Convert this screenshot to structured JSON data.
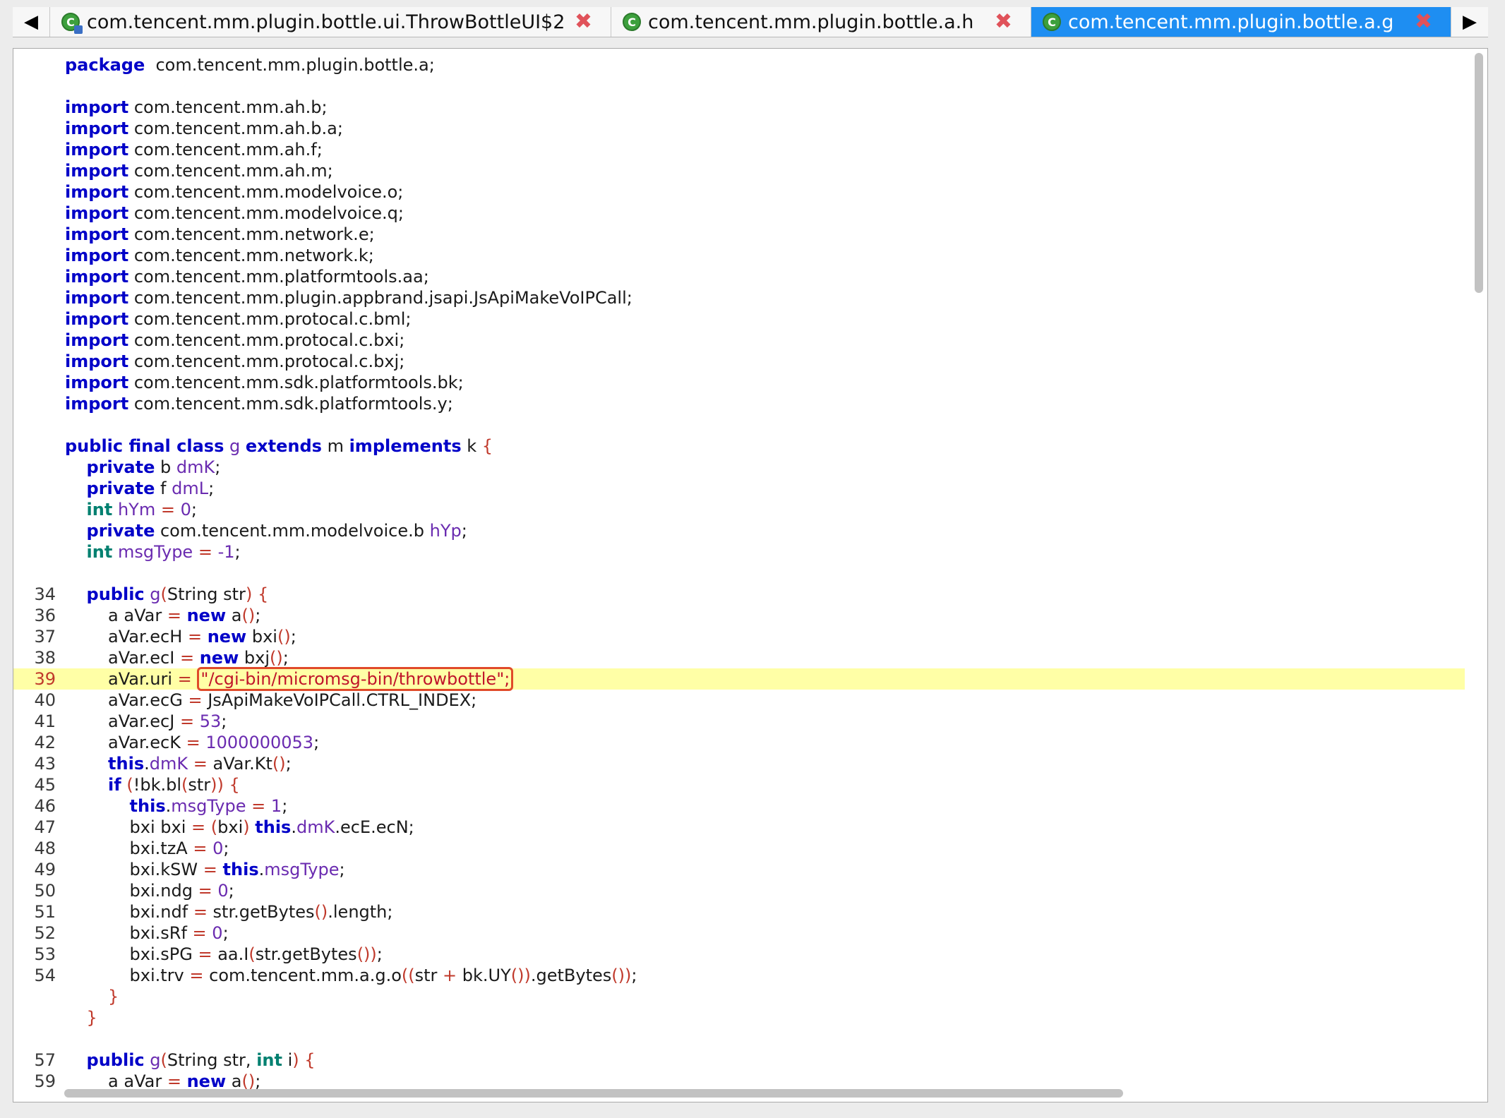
{
  "tabs": [
    {
      "label": "com.tencent.mm.plugin.bottle.ui.ThrowBottleUI$2",
      "icon": "class-icon-with-badge",
      "active": false
    },
    {
      "label": "com.tencent.mm.plugin.bottle.a.h",
      "icon": "class-icon",
      "active": false
    },
    {
      "label": "com.tencent.mm.plugin.bottle.a.g",
      "icon": "class-icon",
      "active": true
    }
  ],
  "nav": {
    "left_arrow": "◀",
    "right_arrow": "▶",
    "close_glyph": "✖"
  },
  "colors": {
    "keyword": "#0000c8",
    "type_keyword": "#008070",
    "field": "#6a2bb0",
    "string": "#c0142a",
    "highlight_line": "#ffffa6",
    "active_tab": "#1e8ef2",
    "highlight_box": "#e04a2a"
  },
  "highlighted_line_number": "39",
  "code_lines": [
    {
      "n": "",
      "t": [
        [
          "kw",
          "package"
        ],
        [
          "",
          "  com.tencent.mm.plugin.bottle.a;"
        ]
      ]
    },
    {
      "n": "",
      "t": []
    },
    {
      "n": "",
      "t": [
        [
          "kw",
          "import"
        ],
        [
          "",
          " com.tencent.mm.ah.b;"
        ]
      ]
    },
    {
      "n": "",
      "t": [
        [
          "kw",
          "import"
        ],
        [
          "",
          " com.tencent.mm.ah.b.a;"
        ]
      ]
    },
    {
      "n": "",
      "t": [
        [
          "kw",
          "import"
        ],
        [
          "",
          " com.tencent.mm.ah.f;"
        ]
      ]
    },
    {
      "n": "",
      "t": [
        [
          "kw",
          "import"
        ],
        [
          "",
          " com.tencent.mm.ah.m;"
        ]
      ]
    },
    {
      "n": "",
      "t": [
        [
          "kw",
          "import"
        ],
        [
          "",
          " com.tencent.mm.modelvoice.o;"
        ]
      ]
    },
    {
      "n": "",
      "t": [
        [
          "kw",
          "import"
        ],
        [
          "",
          " com.tencent.mm.modelvoice.q;"
        ]
      ]
    },
    {
      "n": "",
      "t": [
        [
          "kw",
          "import"
        ],
        [
          "",
          " com.tencent.mm.network.e;"
        ]
      ]
    },
    {
      "n": "",
      "t": [
        [
          "kw",
          "import"
        ],
        [
          "",
          " com.tencent.mm.network.k;"
        ]
      ]
    },
    {
      "n": "",
      "t": [
        [
          "kw",
          "import"
        ],
        [
          "",
          " com.tencent.mm.platformtools.aa;"
        ]
      ]
    },
    {
      "n": "",
      "t": [
        [
          "kw",
          "import"
        ],
        [
          "",
          " com.tencent.mm.plugin.appbrand.jsapi.JsApiMakeVoIPCall;"
        ]
      ]
    },
    {
      "n": "",
      "t": [
        [
          "kw",
          "import"
        ],
        [
          "",
          " com.tencent.mm.protocal.c.bml;"
        ]
      ]
    },
    {
      "n": "",
      "t": [
        [
          "kw",
          "import"
        ],
        [
          "",
          " com.tencent.mm.protocal.c.bxi;"
        ]
      ]
    },
    {
      "n": "",
      "t": [
        [
          "kw",
          "import"
        ],
        [
          "",
          " com.tencent.mm.protocal.c.bxj;"
        ]
      ]
    },
    {
      "n": "",
      "t": [
        [
          "kw",
          "import"
        ],
        [
          "",
          " com.tencent.mm.sdk.platformtools.bk;"
        ]
      ]
    },
    {
      "n": "",
      "t": [
        [
          "kw",
          "import"
        ],
        [
          "",
          " com.tencent.mm.sdk.platformtools.y;"
        ]
      ]
    },
    {
      "n": "",
      "t": []
    },
    {
      "n": "",
      "t": [
        [
          "kw",
          "public final class"
        ],
        [
          "",
          " "
        ],
        [
          "fld",
          "g"
        ],
        [
          "",
          " "
        ],
        [
          "kw",
          "extends"
        ],
        [
          "",
          " m "
        ],
        [
          "kw",
          "implements"
        ],
        [
          "",
          " k "
        ],
        [
          "op",
          "{"
        ]
      ]
    },
    {
      "n": "",
      "t": [
        [
          "",
          "    "
        ],
        [
          "kw",
          "private"
        ],
        [
          "",
          " b "
        ],
        [
          "fld",
          "dmK"
        ],
        [
          "",
          ";"
        ]
      ]
    },
    {
      "n": "",
      "t": [
        [
          "",
          "    "
        ],
        [
          "kw",
          "private"
        ],
        [
          "",
          " f "
        ],
        [
          "fld",
          "dmL"
        ],
        [
          "",
          ";"
        ]
      ]
    },
    {
      "n": "",
      "t": [
        [
          "",
          "    "
        ],
        [
          "kt",
          "int"
        ],
        [
          "",
          " "
        ],
        [
          "fld",
          "hYm"
        ],
        [
          "",
          " "
        ],
        [
          "op",
          "="
        ],
        [
          "",
          " "
        ],
        [
          "num",
          "0"
        ],
        [
          "",
          ";"
        ]
      ]
    },
    {
      "n": "",
      "t": [
        [
          "",
          "    "
        ],
        [
          "kw",
          "private"
        ],
        [
          "",
          " com.tencent.mm.modelvoice.b "
        ],
        [
          "fld",
          "hYp"
        ],
        [
          "",
          ";"
        ]
      ]
    },
    {
      "n": "",
      "t": [
        [
          "",
          "    "
        ],
        [
          "kt",
          "int"
        ],
        [
          "",
          " "
        ],
        [
          "fld",
          "msgType"
        ],
        [
          "",
          " "
        ],
        [
          "op",
          "="
        ],
        [
          "",
          " "
        ],
        [
          "num",
          "-1"
        ],
        [
          "",
          ";"
        ]
      ]
    },
    {
      "n": "",
      "t": []
    },
    {
      "n": "34",
      "t": [
        [
          "",
          "    "
        ],
        [
          "kw",
          "public"
        ],
        [
          "",
          " "
        ],
        [
          "fld",
          "g"
        ],
        [
          "op",
          "("
        ],
        [
          "",
          "String str"
        ],
        [
          "op",
          ")"
        ],
        [
          "",
          " "
        ],
        [
          "op",
          "{"
        ]
      ]
    },
    {
      "n": "36",
      "t": [
        [
          "",
          "        a aVar "
        ],
        [
          "op",
          "="
        ],
        [
          "",
          " "
        ],
        [
          "kw",
          "new"
        ],
        [
          "",
          " a"
        ],
        [
          "op",
          "()"
        ],
        [
          "",
          ";"
        ]
      ]
    },
    {
      "n": "37",
      "t": [
        [
          "",
          "        aVar.ecH "
        ],
        [
          "op",
          "="
        ],
        [
          "",
          " "
        ],
        [
          "kw",
          "new"
        ],
        [
          "",
          " bxi"
        ],
        [
          "op",
          "()"
        ],
        [
          "",
          ";"
        ]
      ]
    },
    {
      "n": "38",
      "t": [
        [
          "",
          "        aVar.ecI "
        ],
        [
          "op",
          "="
        ],
        [
          "",
          " "
        ],
        [
          "kw",
          "new"
        ],
        [
          "",
          " bxj"
        ],
        [
          "op",
          "()"
        ],
        [
          "",
          ";"
        ]
      ]
    },
    {
      "n": "39",
      "t": [
        [
          "",
          "        aVar.uri "
        ],
        [
          "op",
          "="
        ],
        [
          "",
          " "
        ],
        [
          "box",
          "\"/cgi-bin/micromsg-bin/throwbottle\";"
        ]
      ]
    },
    {
      "n": "40",
      "t": [
        [
          "",
          "        aVar.ecG "
        ],
        [
          "op",
          "="
        ],
        [
          "",
          " JsApiMakeVoIPCall.CTRL_INDEX;"
        ]
      ]
    },
    {
      "n": "41",
      "t": [
        [
          "",
          "        aVar.ecJ "
        ],
        [
          "op",
          "="
        ],
        [
          "",
          " "
        ],
        [
          "num",
          "53"
        ],
        [
          "",
          ";"
        ]
      ]
    },
    {
      "n": "42",
      "t": [
        [
          "",
          "        aVar.ecK "
        ],
        [
          "op",
          "="
        ],
        [
          "",
          " "
        ],
        [
          "num",
          "1000000053"
        ],
        [
          "",
          ";"
        ]
      ]
    },
    {
      "n": "43",
      "t": [
        [
          "",
          "        "
        ],
        [
          "kw",
          "this"
        ],
        [
          "",
          "."
        ],
        [
          "fld",
          "dmK"
        ],
        [
          "",
          " "
        ],
        [
          "op",
          "="
        ],
        [
          "",
          " aVar.Kt"
        ],
        [
          "op",
          "()"
        ],
        [
          "",
          ";"
        ]
      ]
    },
    {
      "n": "45",
      "t": [
        [
          "",
          "        "
        ],
        [
          "kw",
          "if"
        ],
        [
          "",
          " "
        ],
        [
          "op",
          "("
        ],
        [
          "",
          "!bk.bl"
        ],
        [
          "op",
          "("
        ],
        [
          "",
          "str"
        ],
        [
          "op",
          "))"
        ],
        [
          "",
          " "
        ],
        [
          "op",
          "{"
        ]
      ]
    },
    {
      "n": "46",
      "t": [
        [
          "",
          "            "
        ],
        [
          "kw",
          "this"
        ],
        [
          "",
          "."
        ],
        [
          "fld",
          "msgType"
        ],
        [
          "",
          " "
        ],
        [
          "op",
          "="
        ],
        [
          "",
          " "
        ],
        [
          "num",
          "1"
        ],
        [
          "",
          ";"
        ]
      ]
    },
    {
      "n": "47",
      "t": [
        [
          "",
          "            bxi bxi "
        ],
        [
          "op",
          "="
        ],
        [
          "",
          " "
        ],
        [
          "op",
          "("
        ],
        [
          "",
          "bxi"
        ],
        [
          "op",
          ")"
        ],
        [
          "",
          " "
        ],
        [
          "kw",
          "this"
        ],
        [
          "",
          "."
        ],
        [
          "fld",
          "dmK"
        ],
        [
          "",
          ".ecE.ecN;"
        ]
      ]
    },
    {
      "n": "48",
      "t": [
        [
          "",
          "            bxi.tzA "
        ],
        [
          "op",
          "="
        ],
        [
          "",
          " "
        ],
        [
          "num",
          "0"
        ],
        [
          "",
          ";"
        ]
      ]
    },
    {
      "n": "49",
      "t": [
        [
          "",
          "            bxi.kSW "
        ],
        [
          "op",
          "="
        ],
        [
          "",
          " "
        ],
        [
          "kw",
          "this"
        ],
        [
          "",
          "."
        ],
        [
          "fld",
          "msgType"
        ],
        [
          "",
          ";"
        ]
      ]
    },
    {
      "n": "50",
      "t": [
        [
          "",
          "            bxi.ndg "
        ],
        [
          "op",
          "="
        ],
        [
          "",
          " "
        ],
        [
          "num",
          "0"
        ],
        [
          "",
          ";"
        ]
      ]
    },
    {
      "n": "51",
      "t": [
        [
          "",
          "            bxi.ndf "
        ],
        [
          "op",
          "="
        ],
        [
          "",
          " str.getBytes"
        ],
        [
          "op",
          "()"
        ],
        [
          "",
          ".length;"
        ]
      ]
    },
    {
      "n": "52",
      "t": [
        [
          "",
          "            bxi.sRf "
        ],
        [
          "op",
          "="
        ],
        [
          "",
          " "
        ],
        [
          "num",
          "0"
        ],
        [
          "",
          ";"
        ]
      ]
    },
    {
      "n": "53",
      "t": [
        [
          "",
          "            bxi.sPG "
        ],
        [
          "op",
          "="
        ],
        [
          "",
          " aa.I"
        ],
        [
          "op",
          "("
        ],
        [
          "",
          "str.getBytes"
        ],
        [
          "op",
          "())"
        ],
        [
          "",
          ";"
        ]
      ]
    },
    {
      "n": "54",
      "t": [
        [
          "",
          "            bxi.trv "
        ],
        [
          "op",
          "="
        ],
        [
          "",
          " com.tencent.mm.a.g.o"
        ],
        [
          "op",
          "(("
        ],
        [
          "",
          "str "
        ],
        [
          "op",
          "+"
        ],
        [
          "",
          " bk.UY"
        ],
        [
          "op",
          "())"
        ],
        [
          "",
          ".getBytes"
        ],
        [
          "op",
          "())"
        ],
        [
          "",
          ";"
        ]
      ]
    },
    {
      "n": "",
      "t": [
        [
          "",
          "        "
        ],
        [
          "op",
          "}"
        ]
      ]
    },
    {
      "n": "",
      "t": [
        [
          "",
          "    "
        ],
        [
          "op",
          "}"
        ]
      ]
    },
    {
      "n": "",
      "t": []
    },
    {
      "n": "57",
      "t": [
        [
          "",
          "    "
        ],
        [
          "kw",
          "public"
        ],
        [
          "",
          " "
        ],
        [
          "fld",
          "g"
        ],
        [
          "op",
          "("
        ],
        [
          "",
          "String str, "
        ],
        [
          "kt",
          "int"
        ],
        [
          "",
          " i"
        ],
        [
          "op",
          ")"
        ],
        [
          "",
          " "
        ],
        [
          "op",
          "{"
        ]
      ]
    },
    {
      "n": "59",
      "t": [
        [
          "",
          "        a aVar "
        ],
        [
          "op",
          "="
        ],
        [
          "",
          " "
        ],
        [
          "kw",
          "new"
        ],
        [
          "",
          " a"
        ],
        [
          "op",
          "()"
        ],
        [
          "",
          ";"
        ]
      ]
    }
  ]
}
